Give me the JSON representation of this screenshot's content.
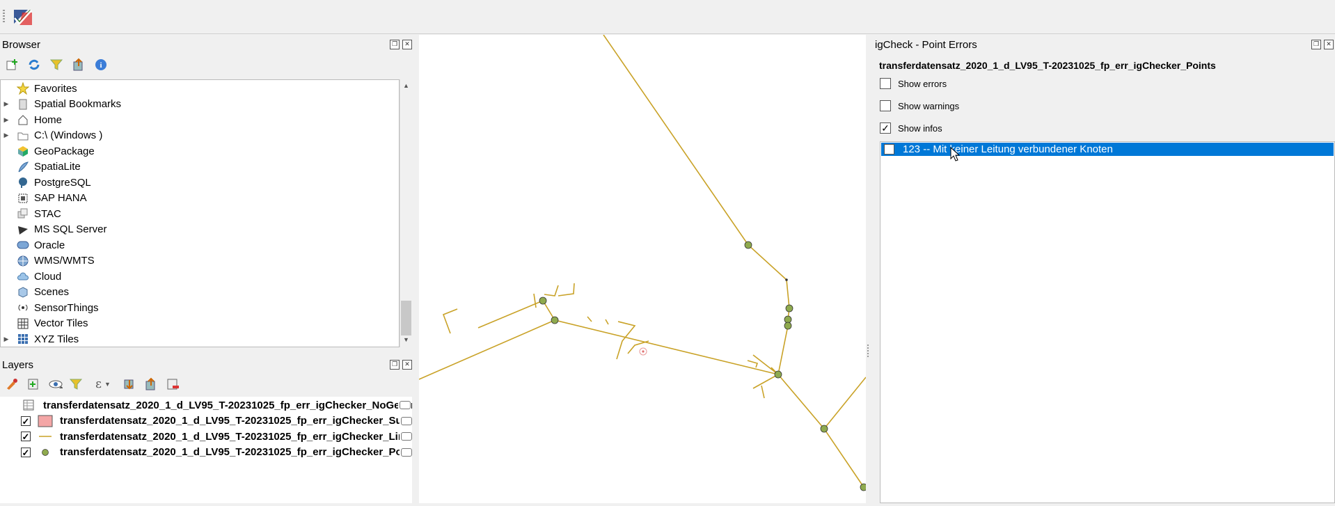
{
  "toolbar": {
    "plugin_icon": "igcheck-plugin-icon"
  },
  "browser": {
    "title": "Browser",
    "toolbar_icons": [
      "add-layer-icon",
      "refresh-icon",
      "filter-icon",
      "collapse-all-icon",
      "info-icon"
    ],
    "items": [
      {
        "label": "Favorites",
        "icon": "star-icon",
        "expandable": false
      },
      {
        "label": "Spatial Bookmarks",
        "icon": "bookmark-icon",
        "expandable": true
      },
      {
        "label": "Home",
        "icon": "home-icon",
        "expandable": true
      },
      {
        "label": "C:\\ (Windows )",
        "icon": "folder-icon",
        "expandable": true
      },
      {
        "label": "GeoPackage",
        "icon": "geopackage-icon",
        "expandable": false
      },
      {
        "label": "SpatiaLite",
        "icon": "spatialite-icon",
        "expandable": false
      },
      {
        "label": "PostgreSQL",
        "icon": "postgresql-icon",
        "expandable": false
      },
      {
        "label": "SAP HANA",
        "icon": "sap-hana-icon",
        "expandable": false
      },
      {
        "label": "STAC",
        "icon": "stac-icon",
        "expandable": false
      },
      {
        "label": "MS SQL Server",
        "icon": "mssql-icon",
        "expandable": false
      },
      {
        "label": "Oracle",
        "icon": "oracle-icon",
        "expandable": false
      },
      {
        "label": "WMS/WMTS",
        "icon": "wms-icon",
        "expandable": false
      },
      {
        "label": "Cloud",
        "icon": "cloud-icon",
        "expandable": false
      },
      {
        "label": "Scenes",
        "icon": "scenes-icon",
        "expandable": false
      },
      {
        "label": "SensorThings",
        "icon": "sensorthings-icon",
        "expandable": false
      },
      {
        "label": "Vector Tiles",
        "icon": "vector-tiles-icon",
        "expandable": false
      },
      {
        "label": "XYZ Tiles",
        "icon": "xyz-tiles-icon",
        "expandable": true
      }
    ]
  },
  "layers": {
    "title": "Layers",
    "items": [
      {
        "name": "transferdatensatz_2020_1_d_LV95_T-20231025_fp_err_igChecker_NoGeom",
        "checked": null,
        "symbol": "table",
        "suffix": "r"
      },
      {
        "name": "transferdatensatz_2020_1_d_LV95_T-20231025_fp_err_igChecker_Surfa",
        "checked": true,
        "symbol": "polygon",
        "suffix": "s"
      },
      {
        "name": "transferdatensatz_2020_1_d_LV95_T-20231025_fp_err_igChecker_Lines",
        "checked": true,
        "symbol": "line",
        "suffix": ""
      },
      {
        "name": "transferdatensatz_2020_1_d_LV95_T-20231025_fp_err_igChecker_Poin",
        "checked": true,
        "symbol": "point",
        "suffix": ""
      }
    ]
  },
  "igcheck": {
    "title": "igCheck - Point Errors",
    "layer_name": "transferdatensatz_2020_1_d_LV95_T-20231025_fp_err_igChecker_Points",
    "options": [
      {
        "label": "Show errors",
        "checked": false
      },
      {
        "label": "Show warnings",
        "checked": false
      },
      {
        "label": "Show infos",
        "checked": true
      }
    ],
    "list_items": [
      {
        "label": "123 -- Mit keiner Leitung verbundener Knoten",
        "selected": true,
        "checked": false
      }
    ]
  },
  "colors": {
    "line": "#c9a227",
    "point_fill": "#8faa4e",
    "point_stroke": "#333333",
    "selection": "#0078d7",
    "polygon_symbol": "#f4a6a6"
  }
}
